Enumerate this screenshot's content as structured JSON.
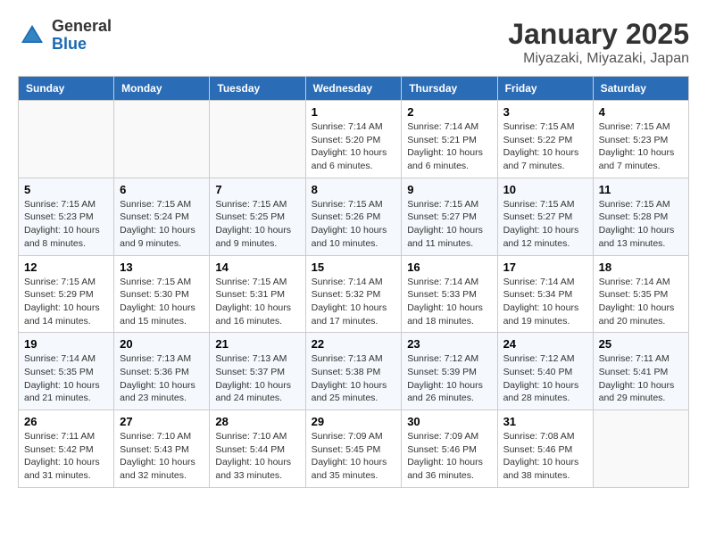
{
  "header": {
    "logo_general": "General",
    "logo_blue": "Blue",
    "month_year": "January 2025",
    "location": "Miyazaki, Miyazaki, Japan"
  },
  "days_of_week": [
    "Sunday",
    "Monday",
    "Tuesday",
    "Wednesday",
    "Thursday",
    "Friday",
    "Saturday"
  ],
  "weeks": [
    [
      {
        "day": "",
        "info": ""
      },
      {
        "day": "",
        "info": ""
      },
      {
        "day": "",
        "info": ""
      },
      {
        "day": "1",
        "info": "Sunrise: 7:14 AM\nSunset: 5:20 PM\nDaylight: 10 hours\nand 6 minutes."
      },
      {
        "day": "2",
        "info": "Sunrise: 7:14 AM\nSunset: 5:21 PM\nDaylight: 10 hours\nand 6 minutes."
      },
      {
        "day": "3",
        "info": "Sunrise: 7:15 AM\nSunset: 5:22 PM\nDaylight: 10 hours\nand 7 minutes."
      },
      {
        "day": "4",
        "info": "Sunrise: 7:15 AM\nSunset: 5:23 PM\nDaylight: 10 hours\nand 7 minutes."
      }
    ],
    [
      {
        "day": "5",
        "info": "Sunrise: 7:15 AM\nSunset: 5:23 PM\nDaylight: 10 hours\nand 8 minutes."
      },
      {
        "day": "6",
        "info": "Sunrise: 7:15 AM\nSunset: 5:24 PM\nDaylight: 10 hours\nand 9 minutes."
      },
      {
        "day": "7",
        "info": "Sunrise: 7:15 AM\nSunset: 5:25 PM\nDaylight: 10 hours\nand 9 minutes."
      },
      {
        "day": "8",
        "info": "Sunrise: 7:15 AM\nSunset: 5:26 PM\nDaylight: 10 hours\nand 10 minutes."
      },
      {
        "day": "9",
        "info": "Sunrise: 7:15 AM\nSunset: 5:27 PM\nDaylight: 10 hours\nand 11 minutes."
      },
      {
        "day": "10",
        "info": "Sunrise: 7:15 AM\nSunset: 5:27 PM\nDaylight: 10 hours\nand 12 minutes."
      },
      {
        "day": "11",
        "info": "Sunrise: 7:15 AM\nSunset: 5:28 PM\nDaylight: 10 hours\nand 13 minutes."
      }
    ],
    [
      {
        "day": "12",
        "info": "Sunrise: 7:15 AM\nSunset: 5:29 PM\nDaylight: 10 hours\nand 14 minutes."
      },
      {
        "day": "13",
        "info": "Sunrise: 7:15 AM\nSunset: 5:30 PM\nDaylight: 10 hours\nand 15 minutes."
      },
      {
        "day": "14",
        "info": "Sunrise: 7:15 AM\nSunset: 5:31 PM\nDaylight: 10 hours\nand 16 minutes."
      },
      {
        "day": "15",
        "info": "Sunrise: 7:14 AM\nSunset: 5:32 PM\nDaylight: 10 hours\nand 17 minutes."
      },
      {
        "day": "16",
        "info": "Sunrise: 7:14 AM\nSunset: 5:33 PM\nDaylight: 10 hours\nand 18 minutes."
      },
      {
        "day": "17",
        "info": "Sunrise: 7:14 AM\nSunset: 5:34 PM\nDaylight: 10 hours\nand 19 minutes."
      },
      {
        "day": "18",
        "info": "Sunrise: 7:14 AM\nSunset: 5:35 PM\nDaylight: 10 hours\nand 20 minutes."
      }
    ],
    [
      {
        "day": "19",
        "info": "Sunrise: 7:14 AM\nSunset: 5:35 PM\nDaylight: 10 hours\nand 21 minutes."
      },
      {
        "day": "20",
        "info": "Sunrise: 7:13 AM\nSunset: 5:36 PM\nDaylight: 10 hours\nand 23 minutes."
      },
      {
        "day": "21",
        "info": "Sunrise: 7:13 AM\nSunset: 5:37 PM\nDaylight: 10 hours\nand 24 minutes."
      },
      {
        "day": "22",
        "info": "Sunrise: 7:13 AM\nSunset: 5:38 PM\nDaylight: 10 hours\nand 25 minutes."
      },
      {
        "day": "23",
        "info": "Sunrise: 7:12 AM\nSunset: 5:39 PM\nDaylight: 10 hours\nand 26 minutes."
      },
      {
        "day": "24",
        "info": "Sunrise: 7:12 AM\nSunset: 5:40 PM\nDaylight: 10 hours\nand 28 minutes."
      },
      {
        "day": "25",
        "info": "Sunrise: 7:11 AM\nSunset: 5:41 PM\nDaylight: 10 hours\nand 29 minutes."
      }
    ],
    [
      {
        "day": "26",
        "info": "Sunrise: 7:11 AM\nSunset: 5:42 PM\nDaylight: 10 hours\nand 31 minutes."
      },
      {
        "day": "27",
        "info": "Sunrise: 7:10 AM\nSunset: 5:43 PM\nDaylight: 10 hours\nand 32 minutes."
      },
      {
        "day": "28",
        "info": "Sunrise: 7:10 AM\nSunset: 5:44 PM\nDaylight: 10 hours\nand 33 minutes."
      },
      {
        "day": "29",
        "info": "Sunrise: 7:09 AM\nSunset: 5:45 PM\nDaylight: 10 hours\nand 35 minutes."
      },
      {
        "day": "30",
        "info": "Sunrise: 7:09 AM\nSunset: 5:46 PM\nDaylight: 10 hours\nand 36 minutes."
      },
      {
        "day": "31",
        "info": "Sunrise: 7:08 AM\nSunset: 5:46 PM\nDaylight: 10 hours\nand 38 minutes."
      },
      {
        "day": "",
        "info": ""
      }
    ]
  ]
}
